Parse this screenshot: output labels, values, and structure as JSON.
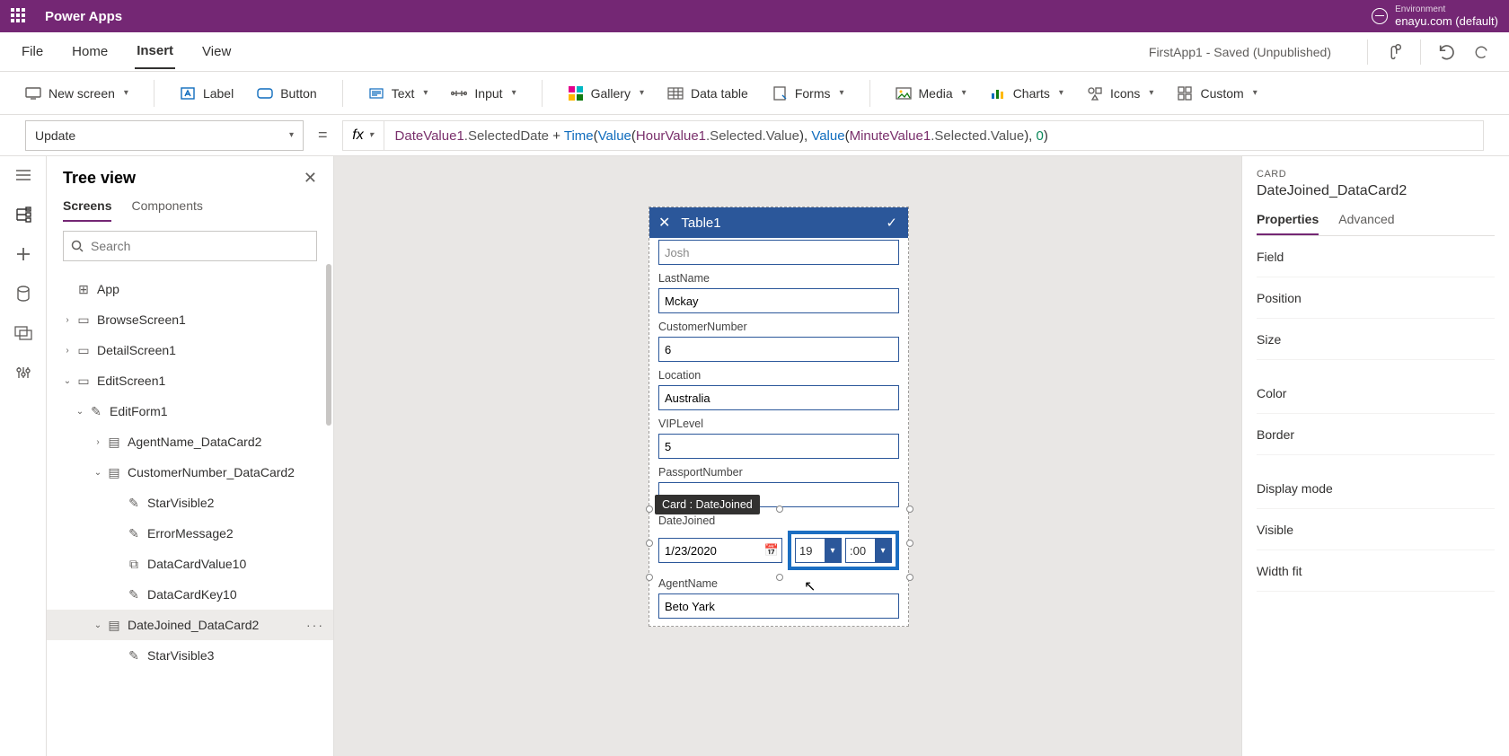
{
  "app_title": "Power Apps",
  "environment": {
    "label": "Environment",
    "value": "enayu.com (default)"
  },
  "menu": {
    "file": "File",
    "home": "Home",
    "insert": "Insert",
    "view": "View",
    "status": "FirstApp1 - Saved (Unpublished)"
  },
  "ribbon": {
    "new_screen": "New screen",
    "label": "Label",
    "button": "Button",
    "text": "Text",
    "input": "Input",
    "gallery": "Gallery",
    "data_table": "Data table",
    "forms": "Forms",
    "media": "Media",
    "charts": "Charts",
    "icons": "Icons",
    "custom": "Custom"
  },
  "formula": {
    "property": "Update",
    "parts": {
      "p1": "DateValue1",
      "p2": ".SelectedDate ",
      "p3": "+ ",
      "p4": "Time",
      "p5": "(",
      "p6": "Value",
      "p7": "(",
      "p8": "HourValue1",
      "p9": ".Selected.Value",
      "p10": "), ",
      "p11": "Value",
      "p12": "(",
      "p13": "MinuteValue1",
      "p14": ".Selected.Value",
      "p15": "), ",
      "p16": "0",
      "p17": ")"
    },
    "fx": "fx"
  },
  "tree": {
    "title": "Tree view",
    "tabs": {
      "screens": "Screens",
      "components": "Components"
    },
    "search_placeholder": "Search",
    "items": {
      "app": "App",
      "browse": "BrowseScreen1",
      "detail": "DetailScreen1",
      "edit": "EditScreen1",
      "editform": "EditForm1",
      "agentcard": "AgentName_DataCard2",
      "custcard": "CustomerNumber_DataCard2",
      "starvisible2": "StarVisible2",
      "errormsg2": "ErrorMessage2",
      "dcvalue10": "DataCardValue10",
      "dckey10": "DataCardKey10",
      "datejoinedcard": "DateJoined_DataCard2",
      "starvisible3": "StarVisible3"
    },
    "more": "···"
  },
  "canvas": {
    "title": "Table1",
    "tooltip": "Card : DateJoined",
    "fields": {
      "firstname": {
        "value": "Josh"
      },
      "lastname": {
        "label": "LastName",
        "value": "Mckay"
      },
      "customernumber": {
        "label": "CustomerNumber",
        "value": "6"
      },
      "location": {
        "label": "Location",
        "value": "Australia"
      },
      "viplevel": {
        "label": "VIPLevel",
        "value": "5"
      },
      "passportnumber": {
        "label": "PassportNumber",
        "value": ""
      },
      "datejoined": {
        "label": "DateJoined",
        "date": "1/23/2020",
        "hour": "19",
        "minute": "00",
        "colon": ":"
      },
      "agentname": {
        "label": "AgentName",
        "value": "Beto Yark"
      }
    }
  },
  "props": {
    "type": "CARD",
    "name": "DateJoined_DataCard2",
    "tabs": {
      "properties": "Properties",
      "advanced": "Advanced"
    },
    "rows": {
      "field": "Field",
      "position": "Position",
      "size": "Size",
      "color": "Color",
      "border": "Border",
      "display_mode": "Display mode",
      "visible": "Visible",
      "width_fit": "Width fit"
    }
  }
}
